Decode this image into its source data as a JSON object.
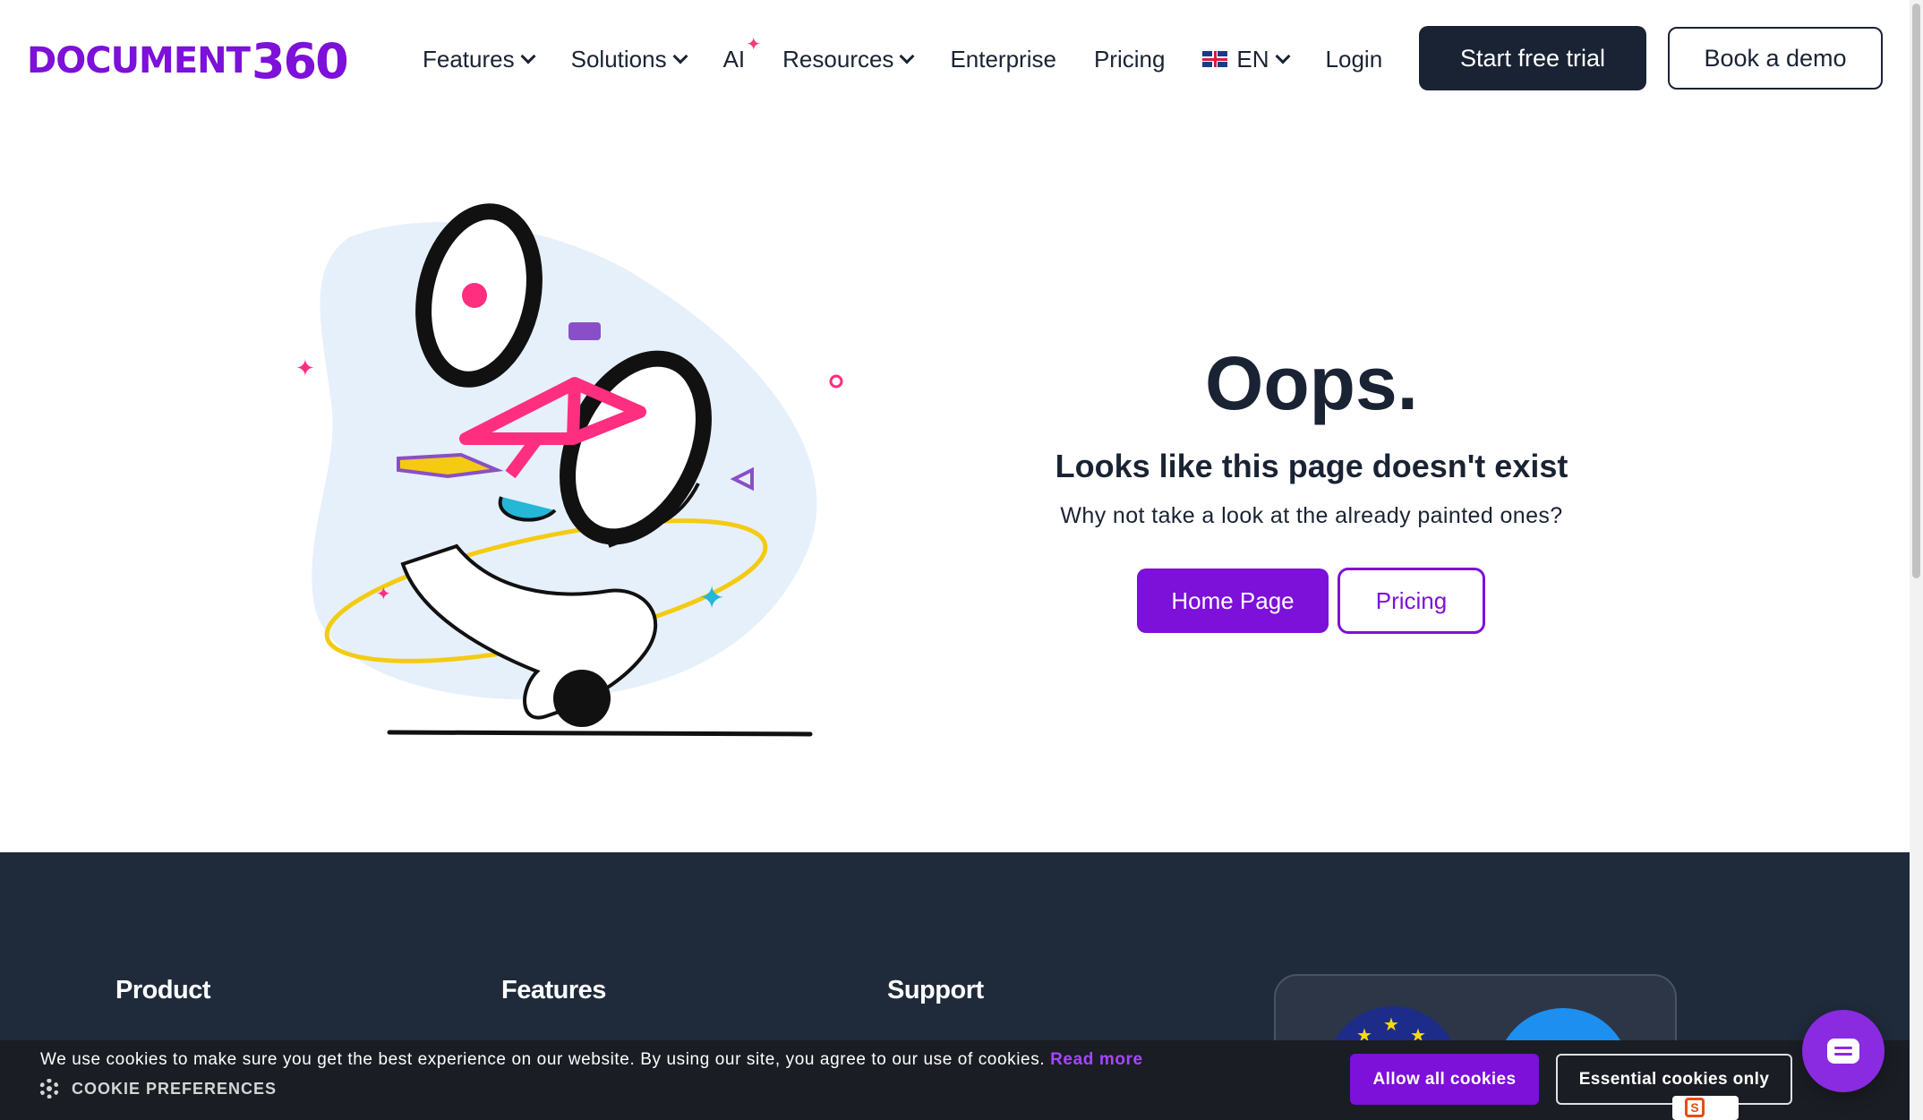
{
  "brand": {
    "logo_word": "DOCUMENT",
    "logo_num": "360",
    "accent": "#7d10d9",
    "dark": "#1a2333"
  },
  "nav": {
    "features": "Features",
    "solutions": "Solutions",
    "ai": "AI",
    "resources": "Resources",
    "enterprise": "Enterprise",
    "pricing": "Pricing",
    "language": "EN",
    "login": "Login",
    "trial": "Start free trial",
    "demo": "Book a demo"
  },
  "error": {
    "title": "Oops.",
    "subtitle": "Looks like this page doesn't exist",
    "description": "Why not take a look at the already painted ones?",
    "home_button": "Home Page",
    "pricing_button": "Pricing"
  },
  "footer": {
    "col1": "Product",
    "col2": "Features",
    "col3": "Support"
  },
  "cookie": {
    "message": "We use cookies to make sure you get the best experience on our website. By using our site, you agree to our use of cookies.",
    "read_more": "Read more",
    "preferences": "COOKIE PREFERENCES",
    "allow_all": "Allow all cookies",
    "essential": "Essential cookies only"
  },
  "icons": {
    "chat": "chat-bubble-icon",
    "flag": "uk-flag-icon",
    "gear": "gear-icon"
  }
}
